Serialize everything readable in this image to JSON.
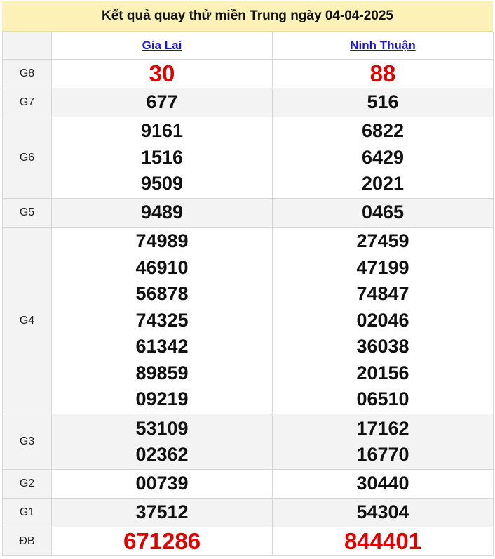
{
  "title": "Kết quả quay thử miền Trung ngày 04-04-2025",
  "provinces": [
    "Gia Lai",
    "Ninh Thuận"
  ],
  "prizes": [
    {
      "label": "G8",
      "values": [
        [
          "30"
        ],
        [
          "88"
        ]
      ]
    },
    {
      "label": "G7",
      "values": [
        [
          "677"
        ],
        [
          "516"
        ]
      ]
    },
    {
      "label": "G6",
      "values": [
        [
          "9161",
          "1516",
          "9509"
        ],
        [
          "6822",
          "6429",
          "2021"
        ]
      ]
    },
    {
      "label": "G5",
      "values": [
        [
          "9489"
        ],
        [
          "0465"
        ]
      ]
    },
    {
      "label": "G4",
      "values": [
        [
          "74989",
          "46910",
          "56878",
          "74325",
          "61342",
          "89859",
          "09219"
        ],
        [
          "27459",
          "47199",
          "74847",
          "02046",
          "36038",
          "20156",
          "06510"
        ]
      ]
    },
    {
      "label": "G3",
      "values": [
        [
          "53109",
          "02362"
        ],
        [
          "17162",
          "16770"
        ]
      ]
    },
    {
      "label": "G2",
      "values": [
        [
          "00739"
        ],
        [
          "30440"
        ]
      ]
    },
    {
      "label": "G1",
      "values": [
        [
          "37512"
        ],
        [
          "54304"
        ]
      ]
    },
    {
      "label": "ĐB",
      "values": [
        [
          "671286"
        ],
        [
          "844401"
        ]
      ]
    }
  ],
  "colors": {
    "title_bg": "#fcf2b8",
    "link": "#1a16d8",
    "highlight": "#e00000"
  }
}
